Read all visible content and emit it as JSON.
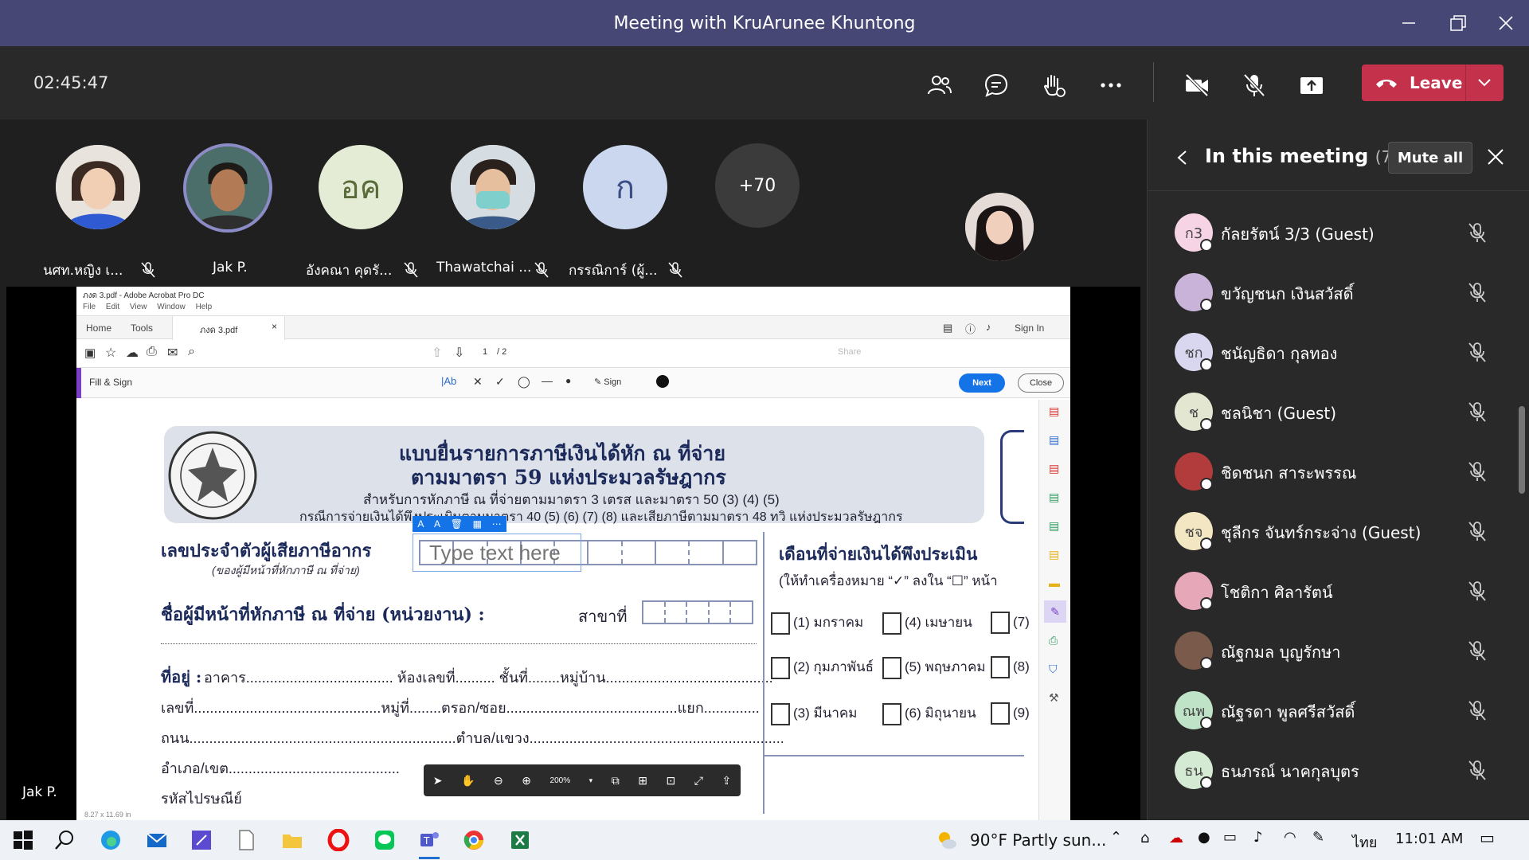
{
  "window": {
    "title": "Meeting with KruArunee Khuntong"
  },
  "toolbar": {
    "timer": "02:45:47",
    "leave_label": "Leave"
  },
  "gallery": [
    {
      "name": "นศท.หญิง เ...",
      "initials": "",
      "muted": true
    },
    {
      "name": "Jak P.",
      "initials": "",
      "muted": false
    },
    {
      "name": "อังคณา คุดรั...",
      "initials": "อค",
      "muted": true
    },
    {
      "name": "Thawatchai ...",
      "initials": "",
      "muted": true
    },
    {
      "name": "กรรณิการ์ (ผู้...",
      "initials": "ก",
      "muted": true
    },
    {
      "name": "",
      "initials": "+70",
      "muted": false
    }
  ],
  "speaker_label": "Jak P.",
  "acrobat": {
    "title": "ภงด 3.pdf - Adobe Acrobat Pro DC",
    "menu": [
      "File",
      "Edit",
      "View",
      "Window",
      "Help"
    ],
    "tabs": {
      "home": "Home",
      "tools": "Tools",
      "doc": "ภงด 3.pdf",
      "signin": "Sign In"
    },
    "page": {
      "current": "1",
      "total": "/ 2"
    },
    "share_label": "Share",
    "fillsign": {
      "label": "Fill & Sign",
      "sign": "Sign",
      "next": "Next",
      "close": "Close"
    },
    "zoom": "200%",
    "size_label": "8.27 x 11.69 in",
    "form": {
      "title1": "แบบยื่นรายการภาษีเงินได้หัก ณ ที่จ่าย",
      "title2": "ตามมาตรา 59 แห่งประมวลรัษฎากร",
      "sub1": "สำหรับการหักภาษี ณ ที่จ่ายตามมาตรา 3 เตรส และมาตรา 50 (3) (4) (5)",
      "sub2": "กรณีการจ่ายเงินได้พึงประเมินตามมาตรา 40 (5) (6) (7) (8) และเสียภาษีตามมาตรา 48 ทวิ แห่งประมวลรัษฎากร",
      "tax_id_label": "เลขประจำตัวผู้เสียภาษีอากร",
      "tax_id_sub": "(ของผู้มีหน้าที่หักภาษี ณ ที่จ่าย)",
      "placeholder": "Type text here",
      "payer_label": "ชื่อผู้มีหน้าที่หักภาษี ณ ที่จ่าย (หน่วยงาน) :",
      "branch": "สาขาที่",
      "address_label": "ที่อยู่ :",
      "address_line1": "อาคาร..................................... ห้องเลขที่.......... ชั้นที่........หมู่บ้าน..........................................",
      "address_line2": "เลขที่...............................................หมู่ที่........ตรอก/ซอย...........................................แยก..............",
      "address_line3": "ถนน...................................................................ตำบล/แขวง................................................................",
      "address_line4": "อำเภอ/เขต...........................................",
      "address_line5": "รหัสไปรษณีย์",
      "month_title": "เดือนที่จ่ายเงินได้พึงประเมิน",
      "month_hint": "(ให้ทำเครื่องหมาย “✓” ลงใน “☐” หน้า",
      "months": [
        "(1) มกราคม",
        "(4) เมษายน",
        "(7)",
        "(2) กุมภาพันธ์",
        "(5) พฤษภาคม",
        "(8)",
        "(3) มีนาคม",
        "(6) มิถุนายน",
        "(9)"
      ]
    }
  },
  "panel": {
    "title": "In this meeting",
    "count": "(76)",
    "mute_all": "Mute all",
    "participants": [
      {
        "initials": "ก3",
        "name": "กัลยรัตน์ 3/3 (Guest)",
        "color": "#f6d4e6"
      },
      {
        "initials": "",
        "name": "ขวัญชนก เงินสวัสดิ์",
        "color": "#c9b3d9"
      },
      {
        "initials": "ชก",
        "name": "ชนัญธิดา กุลทอง",
        "color": "#d9d7ef"
      },
      {
        "initials": "ช",
        "name": "ชลนิชา (Guest)",
        "color": "#e3e7d1"
      },
      {
        "initials": "",
        "name": "ชิดชนก สาระพรรณ",
        "color": "#b23b3b"
      },
      {
        "initials": "ชจ",
        "name": "ชุลีกร จันทร์กระจ่าง (Guest)",
        "color": "#f3e6c2"
      },
      {
        "initials": "",
        "name": "โชติกา ศิลารัตน์",
        "color": "#e6a8b8"
      },
      {
        "initials": "",
        "name": "ณัฐกมล บุญรักษา",
        "color": "#7a5a4a"
      },
      {
        "initials": "ณพ",
        "name": "ณัฐรดา พูลศรีสวัสดิ์",
        "color": "#bfe3c6"
      },
      {
        "initials": "ธน",
        "name": "ธนภรณ์ นาคกุลบุตร",
        "color": "#d4ead2"
      }
    ]
  },
  "taskbar": {
    "weather": "90°F  Partly sun...",
    "lang": "ไทย",
    "time": "11:01 AM"
  }
}
